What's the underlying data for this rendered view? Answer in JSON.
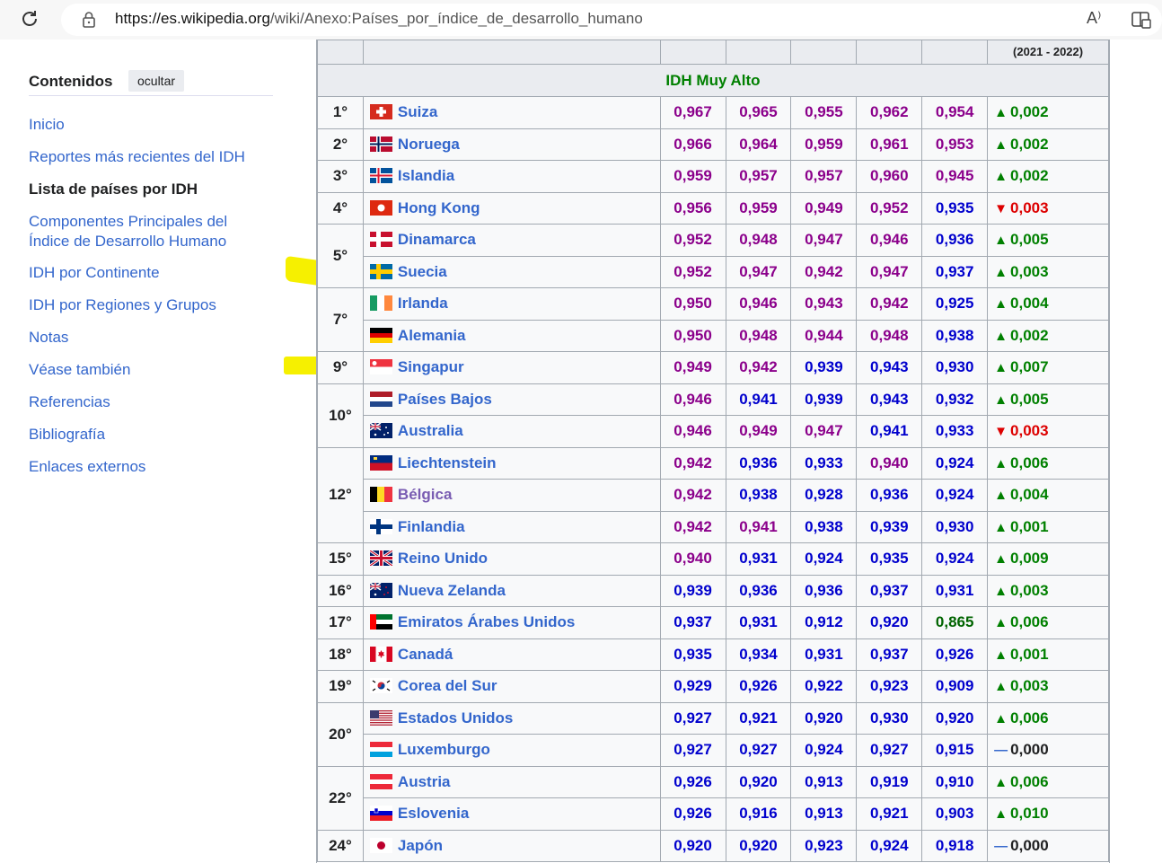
{
  "browser": {
    "url_host": "https://es.wikipedia.org",
    "url_path": "/wiki/Anexo:Países_por_índice_de_desarrollo_humano",
    "reload_icon": "reload-icon",
    "lock_icon": "lock-icon",
    "read_aloud_label": "A⁾",
    "split_icon": "split-screen-icon"
  },
  "toc": {
    "title": "Contenidos",
    "hide_label": "ocultar",
    "items": [
      {
        "label": "Inicio"
      },
      {
        "label": "Reportes más recientes del IDH"
      },
      {
        "label": "Lista de países por IDH",
        "active": true
      },
      {
        "label": "Componentes Principales del Índice de Desarrollo Humano"
      },
      {
        "label": "IDH por Continente"
      },
      {
        "label": "IDH por Regiones y Grupos"
      },
      {
        "label": "Notas"
      },
      {
        "label": "Véase también"
      },
      {
        "label": "Referencias"
      },
      {
        "label": "Bibliografía"
      },
      {
        "label": "Enlaces externos"
      }
    ]
  },
  "table": {
    "header_period": "(2021 - 2022)",
    "section": "IDH Muy Alto",
    "colors": {
      "purple": "#8b008b",
      "blue": "#0000cd",
      "green": "#006400",
      "up": "#008000",
      "down": "#d00"
    },
    "rows": [
      {
        "rank": "1°",
        "country": "Suiza",
        "flag": "CH",
        "vals": [
          "0,967",
          "0,965",
          "0,955",
          "0,962",
          "0,954"
        ],
        "cols": [
          "p",
          "p",
          "p",
          "p",
          "p"
        ],
        "dir": "up",
        "chg": "0,002"
      },
      {
        "rank": "2°",
        "country": "Noruega",
        "flag": "NO",
        "vals": [
          "0,966",
          "0,964",
          "0,959",
          "0,961",
          "0,953"
        ],
        "cols": [
          "p",
          "p",
          "p",
          "p",
          "p"
        ],
        "dir": "up",
        "chg": "0,002"
      },
      {
        "rank": "3°",
        "country": "Islandia",
        "flag": "IS",
        "vals": [
          "0,959",
          "0,957",
          "0,957",
          "0,960",
          "0,945"
        ],
        "cols": [
          "p",
          "p",
          "p",
          "p",
          "p"
        ],
        "dir": "up",
        "chg": "0,002"
      },
      {
        "rank": "4°",
        "country": "Hong Kong",
        "flag": "HK",
        "vals": [
          "0,956",
          "0,959",
          "0,949",
          "0,952",
          "0,935"
        ],
        "cols": [
          "p",
          "p",
          "p",
          "p",
          "b"
        ],
        "dir": "down",
        "chg": "0,003"
      },
      {
        "rank": "5°",
        "span": 2,
        "country": "Dinamarca",
        "flag": "DK",
        "vals": [
          "0,952",
          "0,948",
          "0,947",
          "0,946",
          "0,936"
        ],
        "cols": [
          "p",
          "p",
          "p",
          "p",
          "b"
        ],
        "dir": "up",
        "chg": "0,005"
      },
      {
        "country": "Suecia",
        "flag": "SE",
        "vals": [
          "0,952",
          "0,947",
          "0,942",
          "0,947",
          "0,937"
        ],
        "cols": [
          "p",
          "p",
          "p",
          "p",
          "b"
        ],
        "dir": "up",
        "chg": "0,003"
      },
      {
        "rank": "7°",
        "span": 2,
        "country": "Irlanda",
        "flag": "IE",
        "vals": [
          "0,950",
          "0,946",
          "0,943",
          "0,942",
          "0,925"
        ],
        "cols": [
          "p",
          "p",
          "p",
          "p",
          "b"
        ],
        "dir": "up",
        "chg": "0,004"
      },
      {
        "country": "Alemania",
        "flag": "DE",
        "vals": [
          "0,950",
          "0,948",
          "0,944",
          "0,948",
          "0,938"
        ],
        "cols": [
          "p",
          "p",
          "p",
          "p",
          "b"
        ],
        "dir": "up",
        "chg": "0,002"
      },
      {
        "rank": "9°",
        "country": "Singapur",
        "flag": "SG",
        "vals": [
          "0,949",
          "0,942",
          "0,939",
          "0,943",
          "0,930"
        ],
        "cols": [
          "p",
          "p",
          "b",
          "b",
          "b"
        ],
        "dir": "up",
        "chg": "0,007"
      },
      {
        "rank": "10°",
        "span": 2,
        "country": "Países Bajos",
        "flag": "NL",
        "vals": [
          "0,946",
          "0,941",
          "0,939",
          "0,943",
          "0,932"
        ],
        "cols": [
          "p",
          "b",
          "b",
          "b",
          "b"
        ],
        "dir": "up",
        "chg": "0,005"
      },
      {
        "country": "Australia",
        "flag": "AU",
        "vals": [
          "0,946",
          "0,949",
          "0,947",
          "0,941",
          "0,933"
        ],
        "cols": [
          "p",
          "p",
          "p",
          "b",
          "b"
        ],
        "dir": "down",
        "chg": "0,003"
      },
      {
        "rank": "12°",
        "span": 3,
        "country": "Liechtenstein",
        "flag": "LI",
        "vals": [
          "0,942",
          "0,936",
          "0,933",
          "0,940",
          "0,924"
        ],
        "cols": [
          "p",
          "b",
          "b",
          "p",
          "b"
        ],
        "dir": "up",
        "chg": "0,006"
      },
      {
        "country": "Bélgica",
        "flag": "BE",
        "visited": true,
        "vals": [
          "0,942",
          "0,938",
          "0,928",
          "0,936",
          "0,924"
        ],
        "cols": [
          "p",
          "b",
          "b",
          "b",
          "b"
        ],
        "dir": "up",
        "chg": "0,004"
      },
      {
        "country": "Finlandia",
        "flag": "FI",
        "vals": [
          "0,942",
          "0,941",
          "0,938",
          "0,939",
          "0,930"
        ],
        "cols": [
          "p",
          "p",
          "b",
          "b",
          "b"
        ],
        "dir": "up",
        "chg": "0,001"
      },
      {
        "rank": "15°",
        "country": "Reino Unido",
        "flag": "GB",
        "vals": [
          "0,940",
          "0,931",
          "0,924",
          "0,935",
          "0,924"
        ],
        "cols": [
          "p",
          "b",
          "b",
          "b",
          "b"
        ],
        "dir": "up",
        "chg": "0,009"
      },
      {
        "rank": "16°",
        "country": "Nueva Zelanda",
        "flag": "NZ",
        "vals": [
          "0,939",
          "0,936",
          "0,936",
          "0,937",
          "0,931"
        ],
        "cols": [
          "b",
          "b",
          "b",
          "b",
          "b"
        ],
        "dir": "up",
        "chg": "0,003"
      },
      {
        "rank": "17°",
        "country": "Emiratos Árabes Unidos",
        "flag": "AE",
        "vals": [
          "0,937",
          "0,931",
          "0,912",
          "0,920",
          "0,865"
        ],
        "cols": [
          "b",
          "b",
          "b",
          "b",
          "g"
        ],
        "dir": "up",
        "chg": "0,006"
      },
      {
        "rank": "18°",
        "country": "Canadá",
        "flag": "CA",
        "vals": [
          "0,935",
          "0,934",
          "0,931",
          "0,937",
          "0,926"
        ],
        "cols": [
          "b",
          "b",
          "b",
          "b",
          "b"
        ],
        "dir": "up",
        "chg": "0,001"
      },
      {
        "rank": "19°",
        "country": "Corea del Sur",
        "flag": "KR",
        "vals": [
          "0,929",
          "0,926",
          "0,922",
          "0,923",
          "0,909"
        ],
        "cols": [
          "b",
          "b",
          "b",
          "b",
          "b"
        ],
        "dir": "up",
        "chg": "0,003"
      },
      {
        "rank": "20°",
        "span": 2,
        "country": "Estados Unidos",
        "flag": "US",
        "vals": [
          "0,927",
          "0,921",
          "0,920",
          "0,930",
          "0,920"
        ],
        "cols": [
          "b",
          "b",
          "b",
          "b",
          "b"
        ],
        "dir": "up",
        "chg": "0,006"
      },
      {
        "country": "Luxemburgo",
        "flag": "LU",
        "vals": [
          "0,927",
          "0,927",
          "0,924",
          "0,927",
          "0,915"
        ],
        "cols": [
          "b",
          "b",
          "b",
          "b",
          "b"
        ],
        "dir": "same",
        "chg": "0,000"
      },
      {
        "rank": "22°",
        "span": 2,
        "country": "Austria",
        "flag": "AT",
        "vals": [
          "0,926",
          "0,920",
          "0,913",
          "0,919",
          "0,910"
        ],
        "cols": [
          "b",
          "b",
          "b",
          "b",
          "b"
        ],
        "dir": "up",
        "chg": "0,006"
      },
      {
        "country": "Eslovenia",
        "flag": "SI",
        "vals": [
          "0,926",
          "0,916",
          "0,913",
          "0,921",
          "0,903"
        ],
        "cols": [
          "b",
          "b",
          "b",
          "b",
          "b"
        ],
        "dir": "up",
        "chg": "0,010"
      },
      {
        "rank": "24°",
        "country": "Japón",
        "flag": "JP",
        "vals": [
          "0,920",
          "0,920",
          "0,923",
          "0,924",
          "0,918"
        ],
        "cols": [
          "b",
          "b",
          "b",
          "b",
          "b"
        ],
        "dir": "same",
        "chg": "0,000"
      }
    ]
  }
}
